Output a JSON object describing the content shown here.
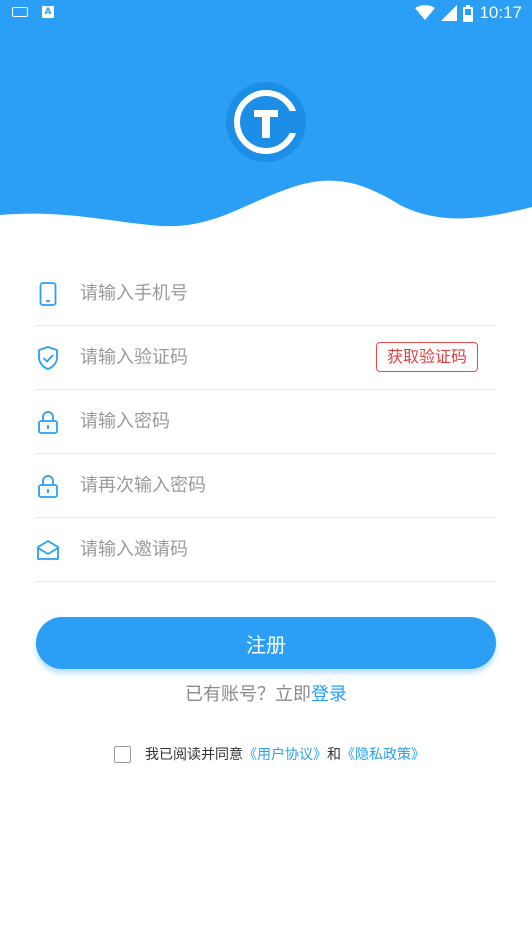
{
  "status_bar": {
    "time": "10:17",
    "a_label": "A"
  },
  "form": {
    "phone_placeholder": "请输入手机号",
    "code_placeholder": "请输入验证码",
    "get_code_label": "获取验证码",
    "password_placeholder": "请输入密码",
    "confirm_password_placeholder": "请再次输入密码",
    "invite_placeholder": "请输入邀请码"
  },
  "register_label": "注册",
  "login_prompt": "已有账号？立即",
  "login_link": "登录",
  "agreement": {
    "text": "我已阅读并同意",
    "user_agreement": "《用户协议》",
    "and": "和",
    "privacy_policy": "《隐私政策》"
  },
  "colors": {
    "primary": "#2a9ff5",
    "danger": "#e04040"
  }
}
